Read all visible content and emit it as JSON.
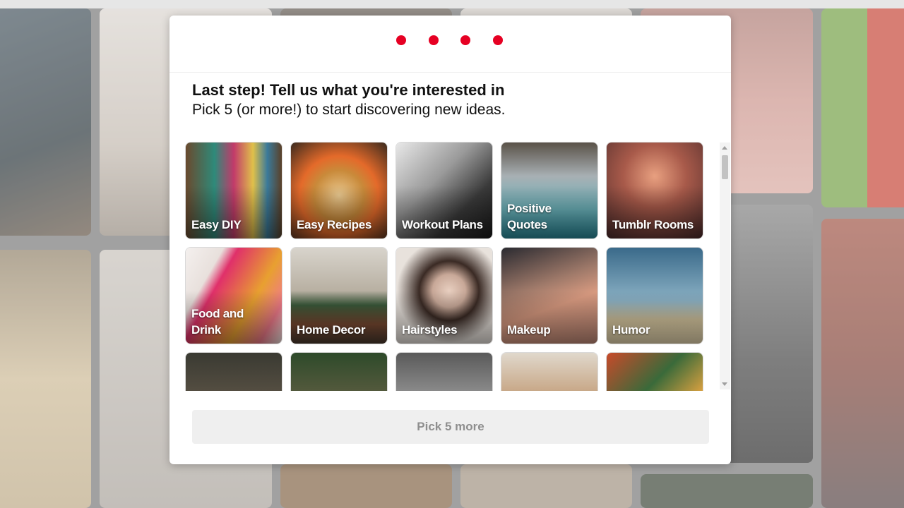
{
  "onboarding": {
    "step_count": 4,
    "title": "Last step! Tell us what you're interested in",
    "subtitle": "Pick 5 (or more!) to start discovering new ideas.",
    "cta_label": "Pick 5 more",
    "accent_color": "#e60023"
  },
  "topics": [
    {
      "label": "Easy DIY"
    },
    {
      "label": "Easy Recipes"
    },
    {
      "label": "Workout Plans"
    },
    {
      "label": "Positive Quotes"
    },
    {
      "label": "Tumblr Rooms"
    },
    {
      "label": "Food and Drink"
    },
    {
      "label": "Home Decor"
    },
    {
      "label": "Hairstyles"
    },
    {
      "label": "Makeup"
    },
    {
      "label": "Humor"
    },
    {
      "label": ""
    },
    {
      "label": ""
    },
    {
      "label": ""
    },
    {
      "label": ""
    },
    {
      "label": ""
    }
  ]
}
